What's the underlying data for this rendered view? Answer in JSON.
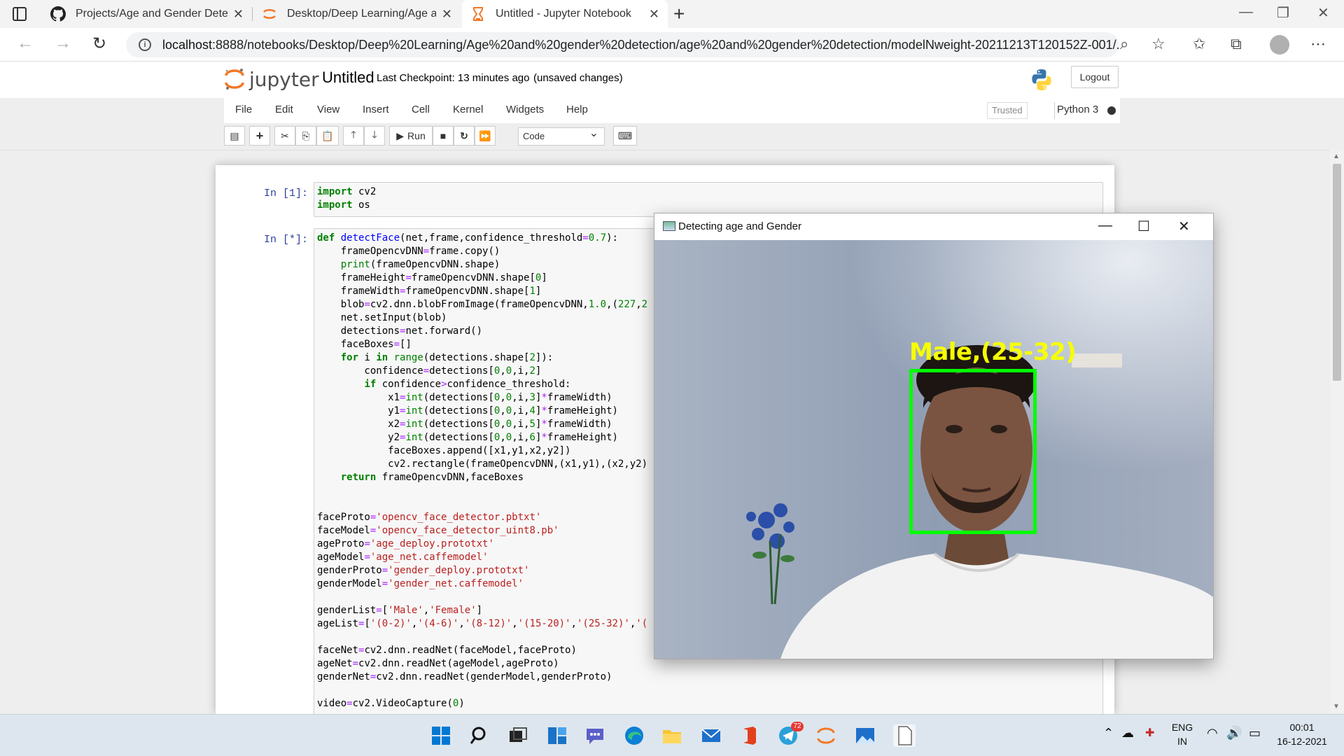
{
  "browser": {
    "tabs": [
      {
        "title": "Projects/Age and Gender Detecti",
        "icon": "github-icon",
        "active": false
      },
      {
        "title": "Desktop/Deep Learning/Age and",
        "icon": "jupyter-icon",
        "active": false
      },
      {
        "title": "Untitled - Jupyter Notebook",
        "icon": "hourglass-icon",
        "active": true
      }
    ],
    "url_host": "localhost",
    "url_path": ":8888/notebooks/Desktop/Deep%20Learning/Age%20and%20gender%20detection/age%20and%20gender%20detection/modelNweight-20211213T120152Z-001/..."
  },
  "jupyter": {
    "logo_text": "jupyter",
    "notebook_name": "Untitled",
    "checkpoint": "Last Checkpoint: 13 minutes ago",
    "unsaved": "(unsaved changes)",
    "logout": "Logout",
    "menu": [
      "File",
      "Edit",
      "View",
      "Insert",
      "Cell",
      "Kernel",
      "Widgets",
      "Help"
    ],
    "trusted": "Trusted",
    "kernel": "Python 3",
    "toolbar": {
      "run": "Run",
      "cell_type": "Code"
    }
  },
  "cells": [
    {
      "prompt": "In [1]:",
      "lines": [
        "import cv2",
        "import os"
      ]
    },
    {
      "prompt": "In [*]:",
      "lines": [
        "def detectFace(net,frame,confidence_threshold=0.7):",
        "    frameOpencvDNN=frame.copy()",
        "    print(frameOpencvDNN.shape)",
        "    frameHeight=frameOpencvDNN.shape[0]",
        "    frameWidth=frameOpencvDNN.shape[1]",
        "    blob=cv2.dnn.blobFromImage(frameOpencvDNN,1.0,(227,2",
        "    net.setInput(blob)",
        "    detections=net.forward()",
        "    faceBoxes=[]",
        "    for i in range(detections.shape[2]):",
        "        confidence=detections[0,0,i,2]",
        "        if confidence>confidence_threshold:",
        "            x1=int(detections[0,0,i,3]*frameWidth)",
        "            y1=int(detections[0,0,i,4]*frameHeight)",
        "            x2=int(detections[0,0,i,5]*frameWidth)",
        "            y2=int(detections[0,0,i,6]*frameHeight)",
        "            faceBoxes.append([x1,y1,x2,y2])",
        "            cv2.rectangle(frameOpencvDNN,(x1,y1),(x2,y2)",
        "    return frameOpencvDNN,faceBoxes",
        "",
        "",
        "faceProto='opencv_face_detector.pbtxt'",
        "faceModel='opencv_face_detector_uint8.pb'",
        "ageProto='age_deploy.prototxt'",
        "ageModel='age_net.caffemodel'",
        "genderProto='gender_deploy.prototxt'",
        "genderModel='gender_net.caffemodel'",
        "",
        "genderList=['Male','Female']",
        "ageList=['(0-2)','(4-6)','(8-12)','(15-20)','(25-32)','(",
        "",
        "faceNet=cv2.dnn.readNet(faceModel,faceProto)",
        "ageNet=cv2.dnn.readNet(ageModel,ageProto)",
        "genderNet=cv2.dnn.readNet(genderModel,genderProto)",
        "",
        "video=cv2.VideoCapture(0)"
      ]
    }
  ],
  "cv_window": {
    "title": "Detecting age and Gender",
    "label": "Male,(25-32)"
  },
  "taskbar": {
    "apps": [
      "windows-start-icon",
      "search-icon",
      "task-view-icon",
      "widgets-icon",
      "teams-chat-icon",
      "edge-icon",
      "file-explorer-icon",
      "mail-icon",
      "office-icon",
      "telegram-icon",
      "jupyter-icon",
      "photos-icon",
      "file-icon"
    ],
    "telegram_badge": "72",
    "lang": "ENG",
    "region": "IN",
    "time": "00:01",
    "date": "16-12-2021"
  }
}
